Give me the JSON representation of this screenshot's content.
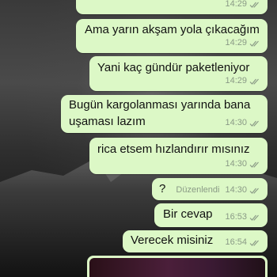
{
  "messages": [
    {
      "text": "",
      "time": "14:29"
    },
    {
      "text": "Ama yarın akşam yola çıkacağım",
      "time": "14:29"
    },
    {
      "text": "Yani kaç gündür paketleniyor",
      "time": "14:29"
    },
    {
      "text_line1": "Bugün kargolanması yarında bana",
      "text_line2": "uşaması lazım",
      "time": "14:30"
    },
    {
      "text": "rica etsem hızlandırır mısınız",
      "time": "14:30"
    },
    {
      "text": "?",
      "edited": "Düzenlendi",
      "time": "14:30"
    },
    {
      "text": "Bir cevap",
      "time": "16:53"
    },
    {
      "text": "Verecek misiniz",
      "time": "16:54"
    }
  ],
  "colors": {
    "outgoing_bubble": "#dcf8c6",
    "meta_text": "#8a9a86",
    "read_ticks": "#8a9a86"
  },
  "icons": {
    "tick": "double-check-icon"
  }
}
